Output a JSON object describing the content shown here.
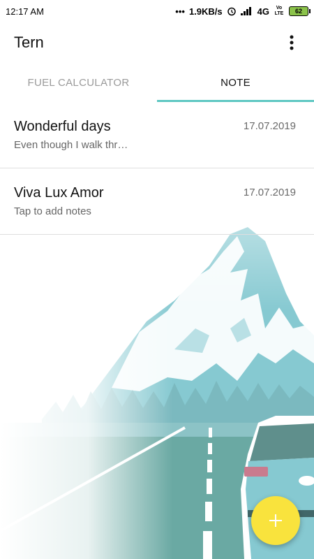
{
  "status_bar": {
    "time": "12:17 AM",
    "dots": "•••",
    "speed": "1.9KB/s",
    "network": "4G",
    "volte": "Vo LTE",
    "battery": "62",
    "icons": [
      "alarm-icon",
      "signal-icon",
      "battery-icon"
    ]
  },
  "app_bar": {
    "title": "Tern",
    "menu_icon": "more-vert-icon"
  },
  "tabs": [
    {
      "label": "FUEL CALCULATOR",
      "active": false
    },
    {
      "label": "NOTE",
      "active": true
    }
  ],
  "notes": [
    {
      "title": "Wonderful days",
      "preview": "Even though I walk thr…",
      "date": "17.07.2019"
    },
    {
      "title": "Viva Lux Amor",
      "preview": "Tap to add notes",
      "date": "17.07.2019"
    }
  ],
  "fab": {
    "icon": "plus-icon"
  },
  "colors": {
    "accent": "#5ec7c2",
    "fab": "#f9e33d",
    "mountain": "#7fc6cf",
    "road": "#6aa9a3"
  }
}
